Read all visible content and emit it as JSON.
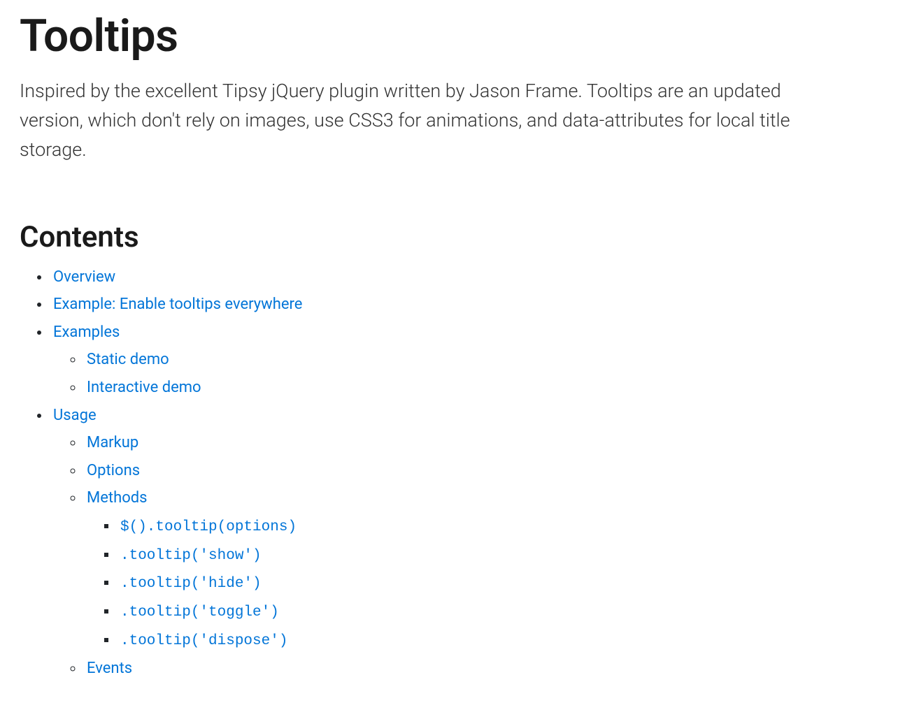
{
  "page": {
    "title": "Tooltips",
    "lead": "Inspired by the excellent Tipsy jQuery plugin written by Jason Frame. Tooltips are an updated version, which don't rely on images, use CSS3 for animations, and data-attributes for local title storage."
  },
  "contents": {
    "heading": "Contents",
    "items": {
      "overview": "Overview",
      "example_enable": "Example: Enable tooltips everywhere",
      "examples": {
        "label": "Examples",
        "static_demo": "Static demo",
        "interactive_demo": "Interactive demo"
      },
      "usage": {
        "label": "Usage",
        "markup": "Markup",
        "options": "Options",
        "methods": {
          "label": "Methods",
          "m1": "$().tooltip(options)",
          "m2": ".tooltip('show')",
          "m3": ".tooltip('hide')",
          "m4": ".tooltip('toggle')",
          "m5": ".tooltip('dispose')"
        },
        "events": "Events"
      }
    }
  }
}
